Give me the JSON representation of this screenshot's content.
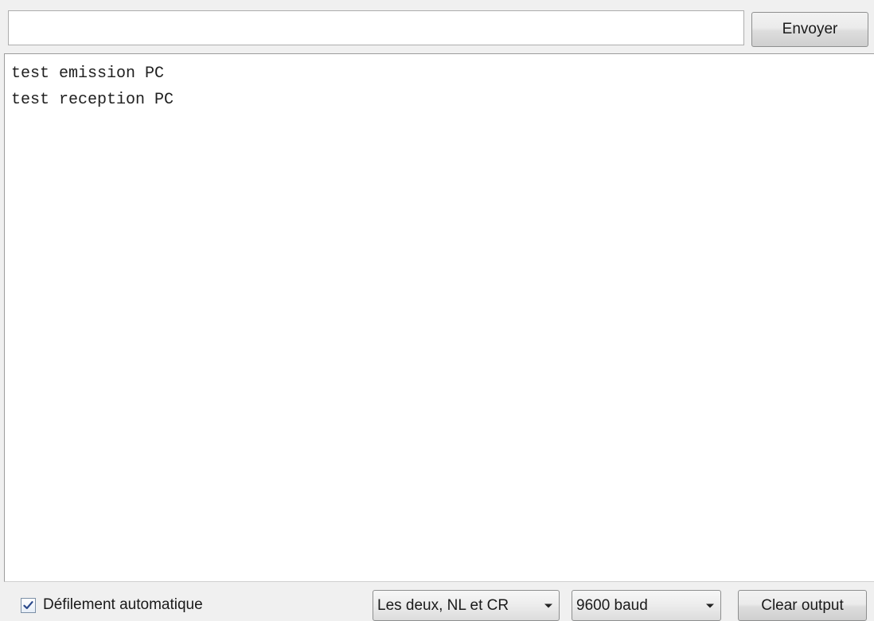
{
  "input": {
    "value": "",
    "placeholder": ""
  },
  "send_button": {
    "label": "Envoyer"
  },
  "output": {
    "lines": [
      "test emission PC",
      "test reception PC"
    ]
  },
  "footer": {
    "autoscroll": {
      "label": "Défilement automatique",
      "checked": true
    },
    "line_ending": {
      "selected": "Les deux, NL et CR"
    },
    "baud_rate": {
      "selected": "9600 baud"
    },
    "clear_button": {
      "label": "Clear output"
    }
  },
  "icons": {
    "checkmark": "checkmark-icon",
    "dropdown": "chevron-down-icon"
  }
}
